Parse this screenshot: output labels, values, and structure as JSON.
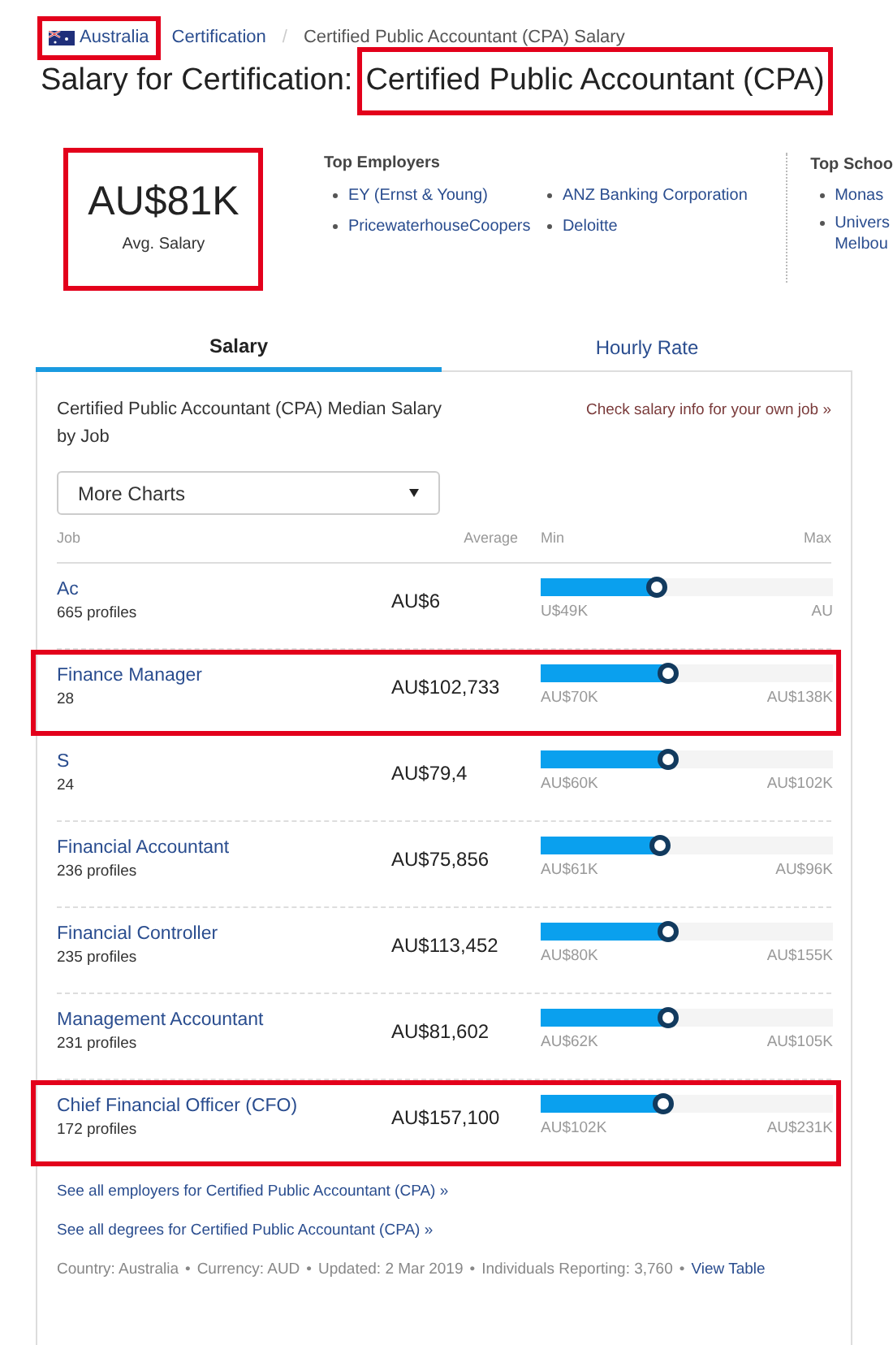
{
  "breadcrumb": [
    {
      "kind": "country",
      "label": "Australia",
      "highlighted": true
    },
    {
      "kind": "link",
      "label": "Certification",
      "highlighted": false
    },
    {
      "kind": "current",
      "label": "Certified Public Accountant (CPA) Salary",
      "highlighted": false
    }
  ],
  "breadcrumb_separator": "/",
  "title": {
    "prefix": "Salary for Certification:",
    "subject": "Certified Public Accountant (CPA)",
    "highlighted": true
  },
  "summary": {
    "value": "AU$81K",
    "label": "Avg. Salary",
    "highlighted": true
  },
  "top_employers": {
    "heading": "Top Employers",
    "items": [
      "EY (Ernst & Young)",
      "ANZ Banking Corporation",
      "PricewaterhouseCoopers",
      "Deloitte"
    ]
  },
  "top_schools": {
    "heading": "Top Schoo",
    "items": [
      [
        "Monas"
      ],
      [
        "Univers",
        "Melbou"
      ]
    ]
  },
  "tabs": [
    {
      "label": "Salary",
      "selected": true
    },
    {
      "label": "Hourly Rate",
      "selected": false
    }
  ],
  "panel": {
    "heading": "Certified Public Accountant (CPA) Median Salary by Job",
    "own_job_link": "Check salary info for your own job »",
    "dropdown": "More Charts",
    "columns": [
      "Job",
      "Average",
      "Min",
      "Max"
    ],
    "rows": [
      {
        "job": "Ac",
        "profiles": "665 profiles",
        "average": "AU$6",
        "level": 0.4,
        "min": "U$49K",
        "max": "AU",
        "highlighted": false
      },
      {
        "job": "Finance Manager",
        "profiles": "28",
        "average": "AU$102,733",
        "level": 0.44,
        "min": "AU$70K",
        "max": "AU$138K",
        "highlighted": true
      },
      {
        "job": "S",
        "profiles": "24",
        "average": "AU$79,4",
        "level": 0.44,
        "min": "AU$60K",
        "max": "AU$102K",
        "highlighted": false
      },
      {
        "job": "Financial Accountant",
        "profiles": "236 profiles",
        "average": "AU$75,856",
        "level": 0.41,
        "min": "AU$61K",
        "max": "AU$96K",
        "highlighted": false
      },
      {
        "job": "Financial Controller",
        "profiles": "235 profiles",
        "average": "AU$113,452",
        "level": 0.44,
        "min": "AU$80K",
        "max": "AU$155K",
        "highlighted": false
      },
      {
        "job": "Management Accountant",
        "profiles": "231 profiles",
        "average": "AU$81,602",
        "level": 0.44,
        "min": "AU$62K",
        "max": "AU$105K",
        "highlighted": false
      },
      {
        "job": "Chief Financial Officer (CFO)",
        "profiles": "172 profiles",
        "average": "AU$157,100",
        "level": 0.42,
        "min": "AU$102K",
        "max": "AU$231K",
        "highlighted": true
      }
    ],
    "links": [
      "See all employers for Certified Public Accountant (CPA) »",
      "See all degrees for Certified Public Accountant (CPA) »"
    ],
    "footer": [
      "Country: Australia",
      "Currency: AUD",
      "Updated: 2 Mar 2019",
      "Individuals Reporting: 3,760"
    ],
    "footer_separator": "•",
    "footer_link": "View Table"
  }
}
